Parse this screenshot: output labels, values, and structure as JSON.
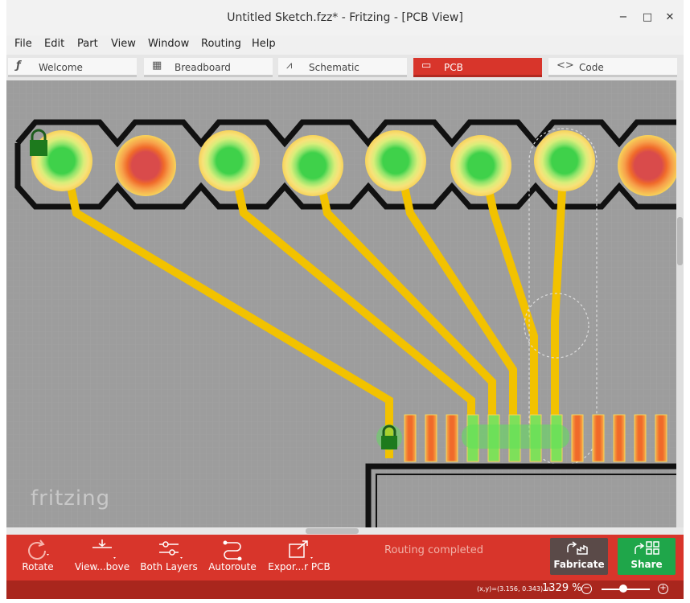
{
  "window": {
    "title": "Untitled Sketch.fzz* - Fritzing - [PCB View]",
    "controls": {
      "minimize": "−",
      "maximize": "□",
      "close": "✕"
    }
  },
  "menu": [
    "File",
    "Edit",
    "Part",
    "View",
    "Window",
    "Routing",
    "Help"
  ],
  "tabs": [
    {
      "label": "Welcome",
      "icon": "fritzing-f-icon",
      "glyph": "ƒ",
      "active": false
    },
    {
      "label": "Breadboard",
      "icon": "breadboard-icon",
      "glyph": "▦",
      "active": false
    },
    {
      "label": "Schematic",
      "icon": "resistor-icon",
      "glyph": "⩘",
      "active": false
    },
    {
      "label": "PCB",
      "icon": "pcb-icon",
      "glyph": "▭",
      "active": true
    },
    {
      "label": "Code",
      "icon": "code-icon",
      "glyph": "<>",
      "active": false
    }
  ],
  "canvas": {
    "logo": "fritzing",
    "colors": {
      "background": "#9d9d9d",
      "trace": "#f2c200",
      "silkscreen": "#000000",
      "pad_green": "#4dd43e",
      "pad_red": "#d94b4b"
    }
  },
  "toolbar": {
    "rotate": "Rotate",
    "view_from_above": "View...bove",
    "both_layers": "Both Layers",
    "autoroute": "Autoroute",
    "export_pcb": "Expor...r PCB",
    "routing_status": "Routing completed",
    "fabricate": "Fabricate",
    "share": "Share"
  },
  "status": {
    "coords": "(x,y)=(3.156, 0.343) in",
    "zoom": "1329 %"
  }
}
